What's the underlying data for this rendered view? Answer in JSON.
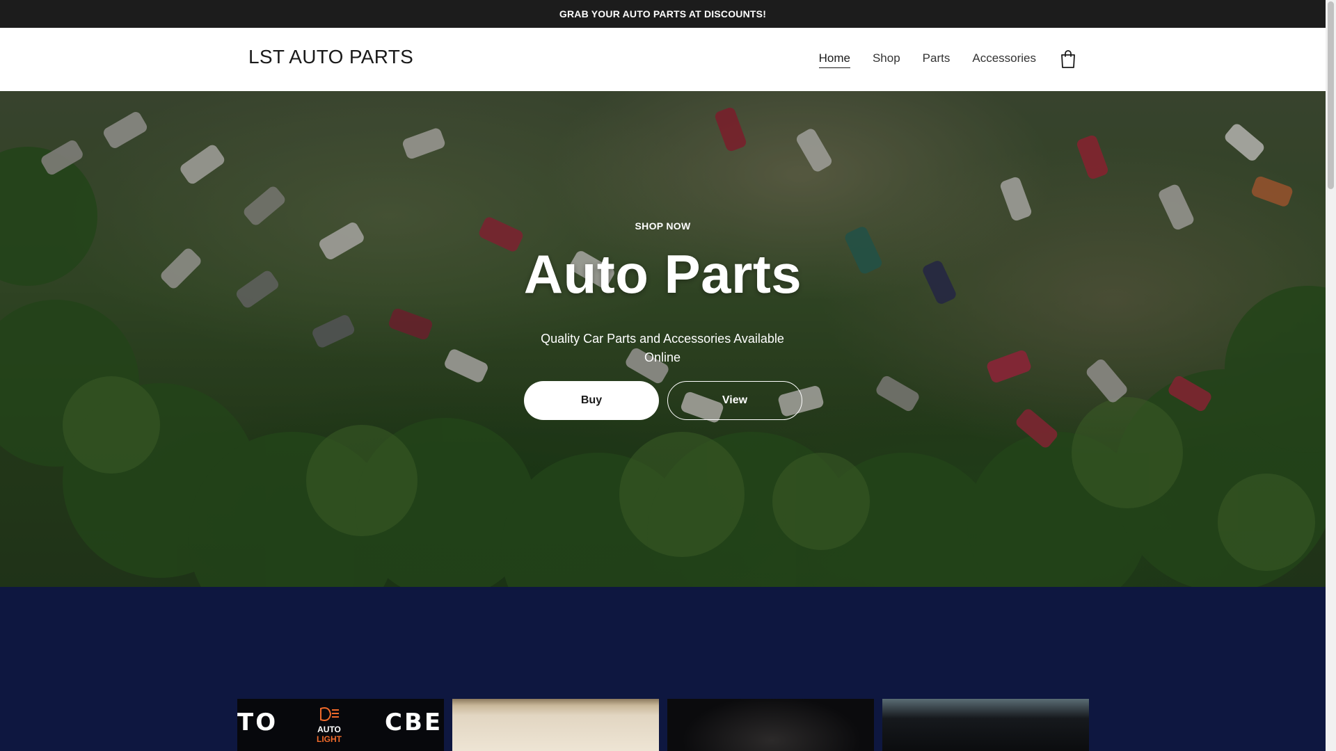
{
  "announcement": {
    "text": "GRAB YOUR AUTO PARTS AT DISCOUNTS!"
  },
  "header": {
    "logo": "LST AUTO PARTS",
    "nav": [
      {
        "label": "Home",
        "active": true
      },
      {
        "label": "Shop",
        "active": false
      },
      {
        "label": "Parts",
        "active": false
      },
      {
        "label": "Accessories",
        "active": false
      }
    ],
    "cart_icon": "shopping-bag-icon"
  },
  "hero": {
    "eyebrow": "SHOP NOW",
    "title": "Auto Parts",
    "subtitle": "Quality Car Parts and Accessories Available Online",
    "primary_button": "Buy",
    "secondary_button": "View"
  },
  "featured": {
    "thumb1": {
      "left_text": "TO",
      "right_text": "CBE",
      "logo_top": "AUTO",
      "logo_bottom": "LIGHT"
    }
  },
  "colors": {
    "announcement_bg": "#1c1c1c",
    "section_blue": "#0e1740",
    "text_dark": "#1a1a1a",
    "white": "#ffffff"
  }
}
